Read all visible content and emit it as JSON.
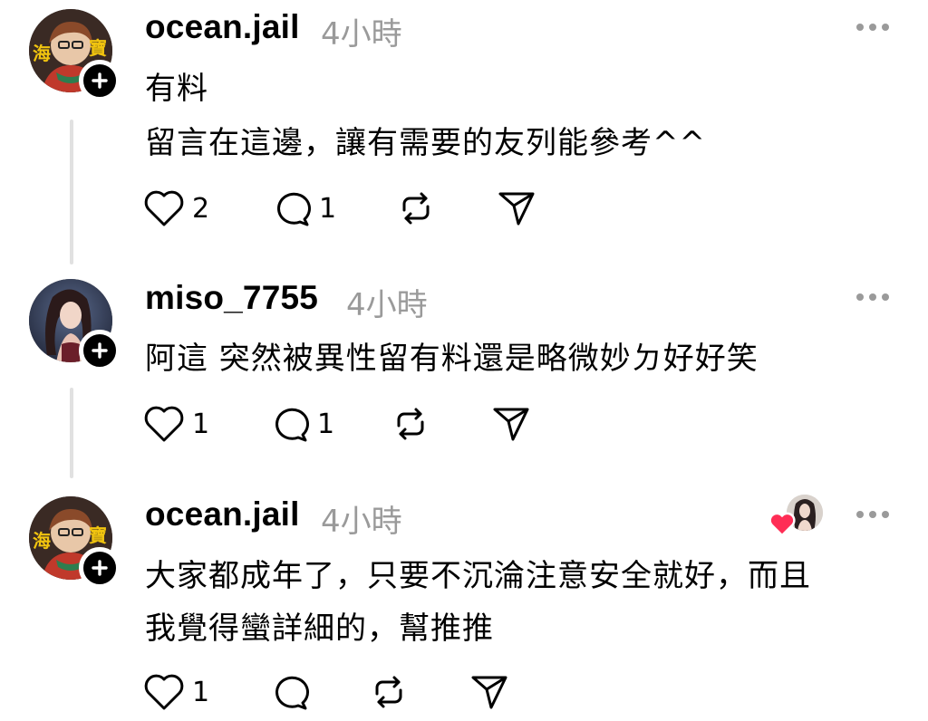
{
  "posts": [
    {
      "username": "ocean.jail",
      "time": "4小時",
      "lines": [
        "有料",
        "留言在這邊，讓有需要的友列能參考^^"
      ],
      "likes": "2",
      "replies": "1",
      "avatar_text": [
        "海",
        "寶"
      ]
    },
    {
      "username": "miso_7755",
      "time": "4小時",
      "lines": [
        "阿這 突然被異性留有料還是略微妙ㄉ好好笑"
      ],
      "likes": "1",
      "replies": "1"
    },
    {
      "username": "ocean.jail",
      "time": "4小時",
      "lines": [
        "大家都成年了，只要不沉淪注意安全就好，而且",
        "我覺得蠻詳細的，幫推推"
      ],
      "likes": "1",
      "replies": "",
      "avatar_text": [
        "海",
        "寶"
      ]
    }
  ],
  "icons": {
    "like": "heart-outline-icon",
    "reply": "speech-bubble-icon",
    "repost": "repost-arrows-icon",
    "share": "send-arrow-icon",
    "more": "more-dots-icon",
    "follow": "plus-icon",
    "liked_by_author": "red-heart-icon"
  },
  "colors": {
    "text": "#000000",
    "muted": "#9a9a9a",
    "heart_red": "#ff2d55",
    "thread_line": "#e1e1e1"
  }
}
